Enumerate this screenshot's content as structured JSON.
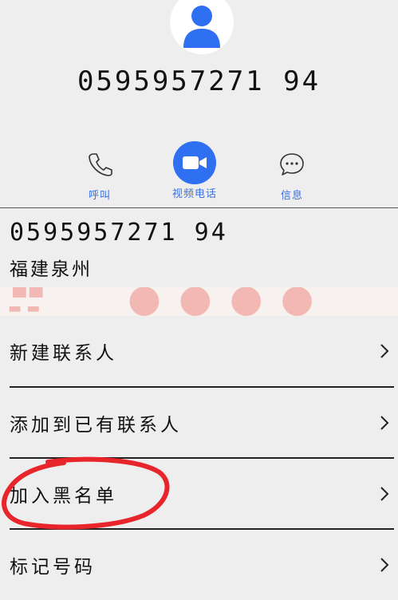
{
  "contact": {
    "number_large": "0595957271 94",
    "number": "0595957271 94",
    "location": "福建泉州"
  },
  "actions": {
    "call_label": "呼叫",
    "video_label": "视频电话",
    "message_label": "信息"
  },
  "menu": {
    "items": [
      {
        "label": "新建联系人"
      },
      {
        "label": "添加到已有联系人"
      },
      {
        "label": "加入黑名单"
      },
      {
        "label": "标记号码"
      }
    ]
  },
  "colors": {
    "accent": "#2f6ff2",
    "action_label": "#3a6fe0",
    "annotation": "#e8252a",
    "background": "#eeeeee"
  },
  "icons": [
    "avatar-icon",
    "phone-icon",
    "video-camera-icon",
    "message-bubble-icon",
    "chevron-right-icon"
  ]
}
